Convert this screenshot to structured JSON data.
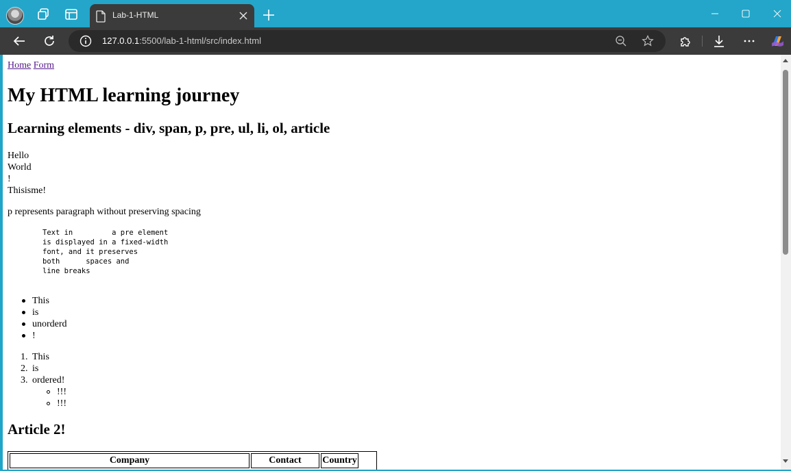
{
  "browser": {
    "tab_title": "Lab-1-HTML",
    "url_host": "127.0.0.1",
    "url_rest": ":5500/lab-1-html/src/index.html"
  },
  "page": {
    "nav": [
      "Home",
      "Form"
    ],
    "h1": "My HTML learning journey",
    "h2": "Learning elements - div, span, p, pre, ul, li, ol, article",
    "lines": [
      "Hello",
      "World",
      "!",
      "Thisisme!"
    ],
    "paragraph": "p represents paragraph without preserving spacing",
    "pre": "Text in         a pre element\nis displayed in a fixed-width\nfont, and it preserves\nboth      spaces and\nline breaks",
    "unordered": [
      "This",
      "is",
      "unorderd",
      "!"
    ],
    "ordered": [
      "This",
      "is",
      "ordered!"
    ],
    "ordered_markers": [
      "1.",
      "2.",
      "3."
    ],
    "nested": [
      "!!!",
      "!!!"
    ],
    "h2_article": "Article 2!",
    "table_headers": [
      "Company",
      "Contact",
      "Country"
    ]
  }
}
